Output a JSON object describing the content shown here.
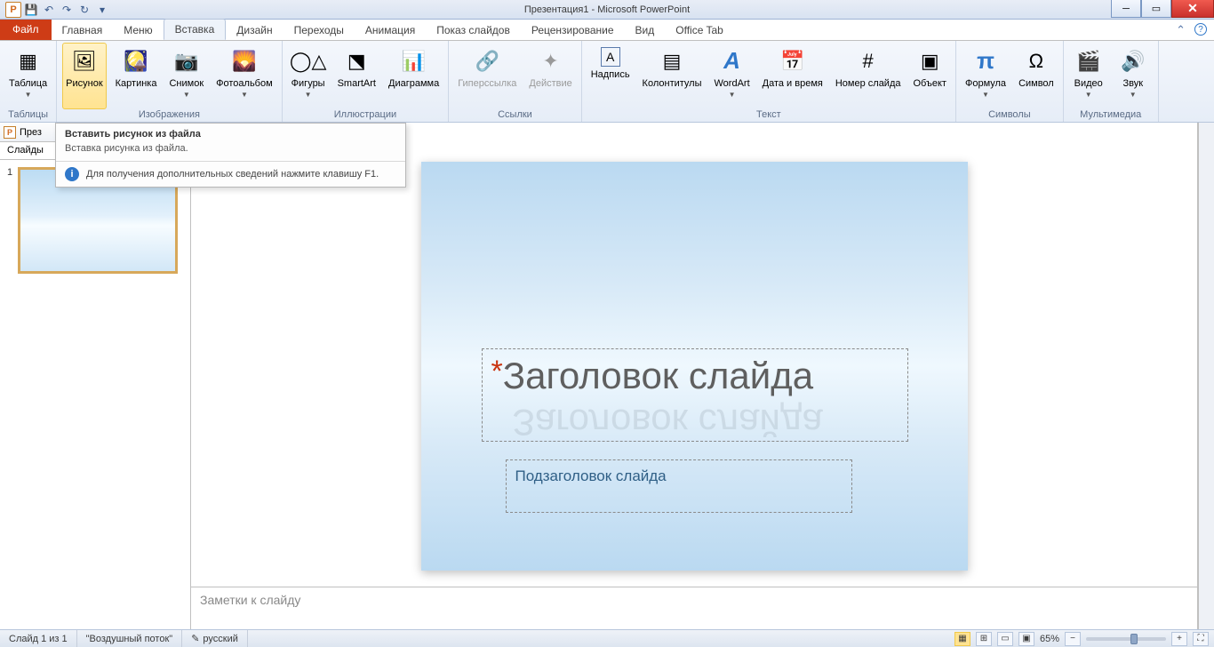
{
  "title": "Презентация1 - Microsoft PowerPoint",
  "qat": {
    "save": "💾",
    "undo": "↶",
    "redo": "↷",
    "refresh": "↻"
  },
  "tabs": {
    "file": "Файл",
    "items": [
      "Главная",
      "Меню",
      "Вставка",
      "Дизайн",
      "Переходы",
      "Анимация",
      "Показ слайдов",
      "Рецензирование",
      "Вид",
      "Office Tab"
    ],
    "active": 2
  },
  "ribbon": {
    "groups": [
      {
        "label": "Таблицы",
        "items": [
          {
            "name": "table",
            "label": "Таблица",
            "dd": true,
            "icon": "▦"
          }
        ]
      },
      {
        "label": "Изображения",
        "items": [
          {
            "name": "picture",
            "label": "Рисунок",
            "hover": true,
            "icon": "🖼"
          },
          {
            "name": "clipart",
            "label": "Картинка",
            "icon": "🎑"
          },
          {
            "name": "screenshot",
            "label": "Снимок",
            "dd": true,
            "icon": "📷"
          },
          {
            "name": "album",
            "label": "Фотоальбом",
            "dd": true,
            "icon": "🌄"
          }
        ]
      },
      {
        "label": "Иллюстрации",
        "items": [
          {
            "name": "shapes",
            "label": "Фигуры",
            "dd": true,
            "icon": "◯△"
          },
          {
            "name": "smartart",
            "label": "SmartArt",
            "icon": "⬔"
          },
          {
            "name": "chart",
            "label": "Диаграмма",
            "icon": "📊"
          }
        ]
      },
      {
        "label": "Ссылки",
        "items": [
          {
            "name": "hyperlink",
            "label": "Гиперссылка",
            "disabled": true,
            "icon": "🔗"
          },
          {
            "name": "action",
            "label": "Действие",
            "disabled": true,
            "icon": "✦"
          }
        ]
      },
      {
        "label": "Текст",
        "items": [
          {
            "name": "textbox",
            "label": "Надпись",
            "icon": "A"
          },
          {
            "name": "headerfooter",
            "label": "Колонтитулы",
            "icon": "▤"
          },
          {
            "name": "wordart",
            "label": "WordArt",
            "dd": true,
            "icon": "A"
          },
          {
            "name": "datetime",
            "label": "Дата и время",
            "icon": "📅"
          },
          {
            "name": "slidenumber",
            "label": "Номер слайда",
            "icon": "#"
          },
          {
            "name": "object",
            "label": "Объект",
            "icon": "▣"
          }
        ]
      },
      {
        "label": "Символы",
        "items": [
          {
            "name": "equation",
            "label": "Формула",
            "dd": true,
            "icon": "π"
          },
          {
            "name": "symbol",
            "label": "Символ",
            "icon": "Ω"
          }
        ]
      },
      {
        "label": "Мультимедиа",
        "items": [
          {
            "name": "video",
            "label": "Видео",
            "dd": true,
            "icon": "🎬"
          },
          {
            "name": "audio",
            "label": "Звук",
            "dd": true,
            "icon": "🔊"
          }
        ]
      }
    ]
  },
  "tooltip": {
    "title": "Вставить рисунок из файла",
    "body": "Вставка рисунка из файла.",
    "help": "Для получения дополнительных сведений нажмите клавишу F1."
  },
  "document": {
    "name": "През"
  },
  "sidebar": {
    "tab": "Слайды",
    "slidenum": "1"
  },
  "slide": {
    "title": "Заголовок слайда",
    "subtitle": "Подзаголовок слайда"
  },
  "notes": {
    "placeholder": "Заметки к слайду"
  },
  "status": {
    "slide": "Слайд 1 из 1",
    "theme": "\"Воздушный поток\"",
    "lang": "русский",
    "zoom": "65%"
  }
}
